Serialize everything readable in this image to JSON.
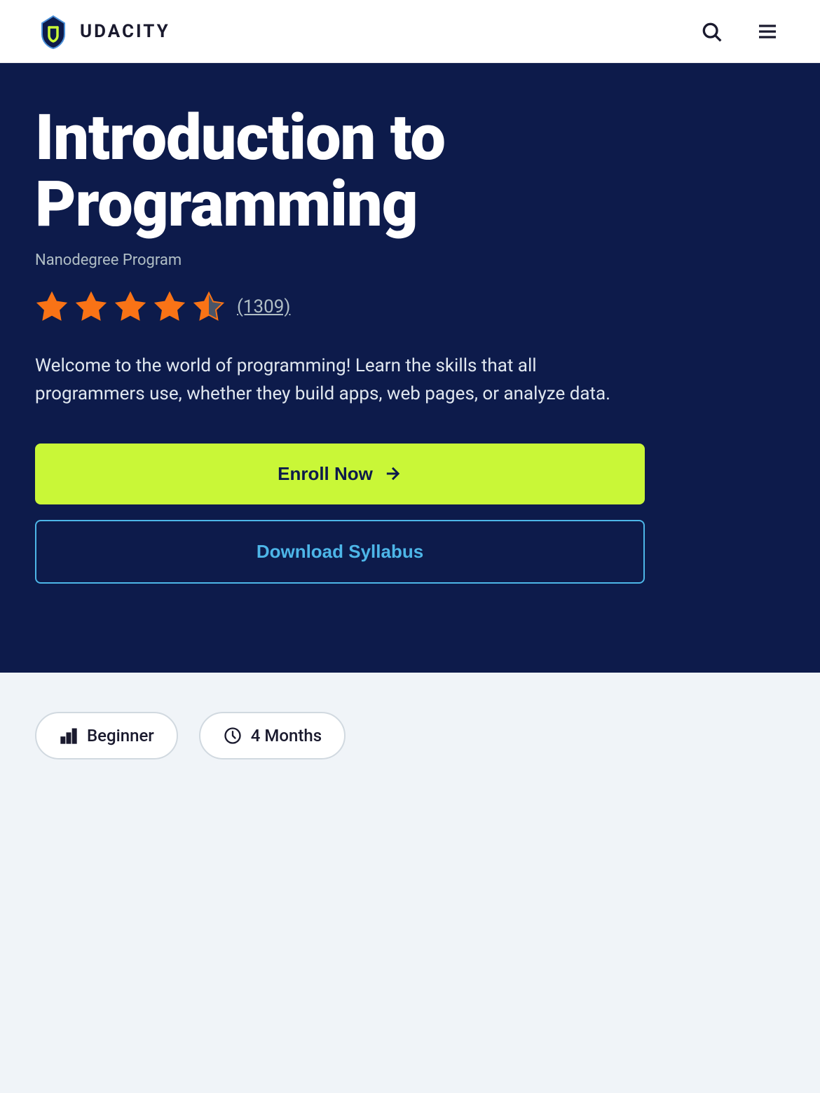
{
  "header": {
    "logo_text": "UDACITY",
    "search_label": "Search",
    "menu_label": "Menu"
  },
  "hero": {
    "title": "Introduction to Programming",
    "subtitle": "Nanodegree Program",
    "rating": {
      "stars": 4.5,
      "count": "(1309)"
    },
    "description": "Welcome to the world of programming! Learn the skills that all programmers use, whether they build apps, web pages, or analyze data.",
    "enroll_label": "Enroll Now",
    "syllabus_label": "Download Syllabus"
  },
  "info": {
    "level_label": "Beginner",
    "duration_label": "4 Months"
  }
}
